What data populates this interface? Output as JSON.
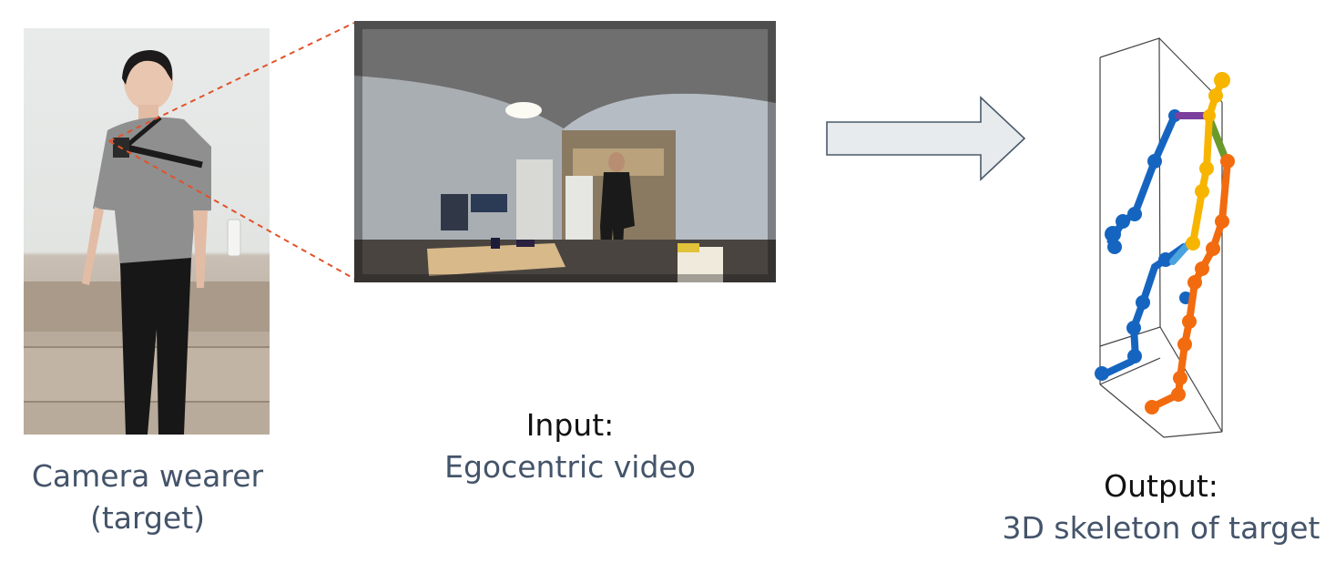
{
  "labels": {
    "camera_wearer_line1": "Camera wearer",
    "camera_wearer_line2": "(target)",
    "input_title": "Input:",
    "input_desc": "Egocentric video",
    "output_title": "Output:",
    "output_desc": "3D skeleton of target"
  },
  "icons": {
    "zoom_lines": "dashed-zoom-connector",
    "arrow": "right-arrow-icon"
  },
  "colors": {
    "caption_dark": "#111111",
    "caption_slate": "#44546a",
    "zoom_line": "#e2522a",
    "arrow_fill": "#e8ebed",
    "arrow_stroke": "#4a5a6a",
    "limb_blue": "#1565c0",
    "limb_yellow": "#f7b500",
    "limb_orange": "#f26b0f",
    "limb_purple": "#7b3f9e",
    "limb_green": "#6a9a2c",
    "limb_lightblue": "#4aa3df"
  }
}
